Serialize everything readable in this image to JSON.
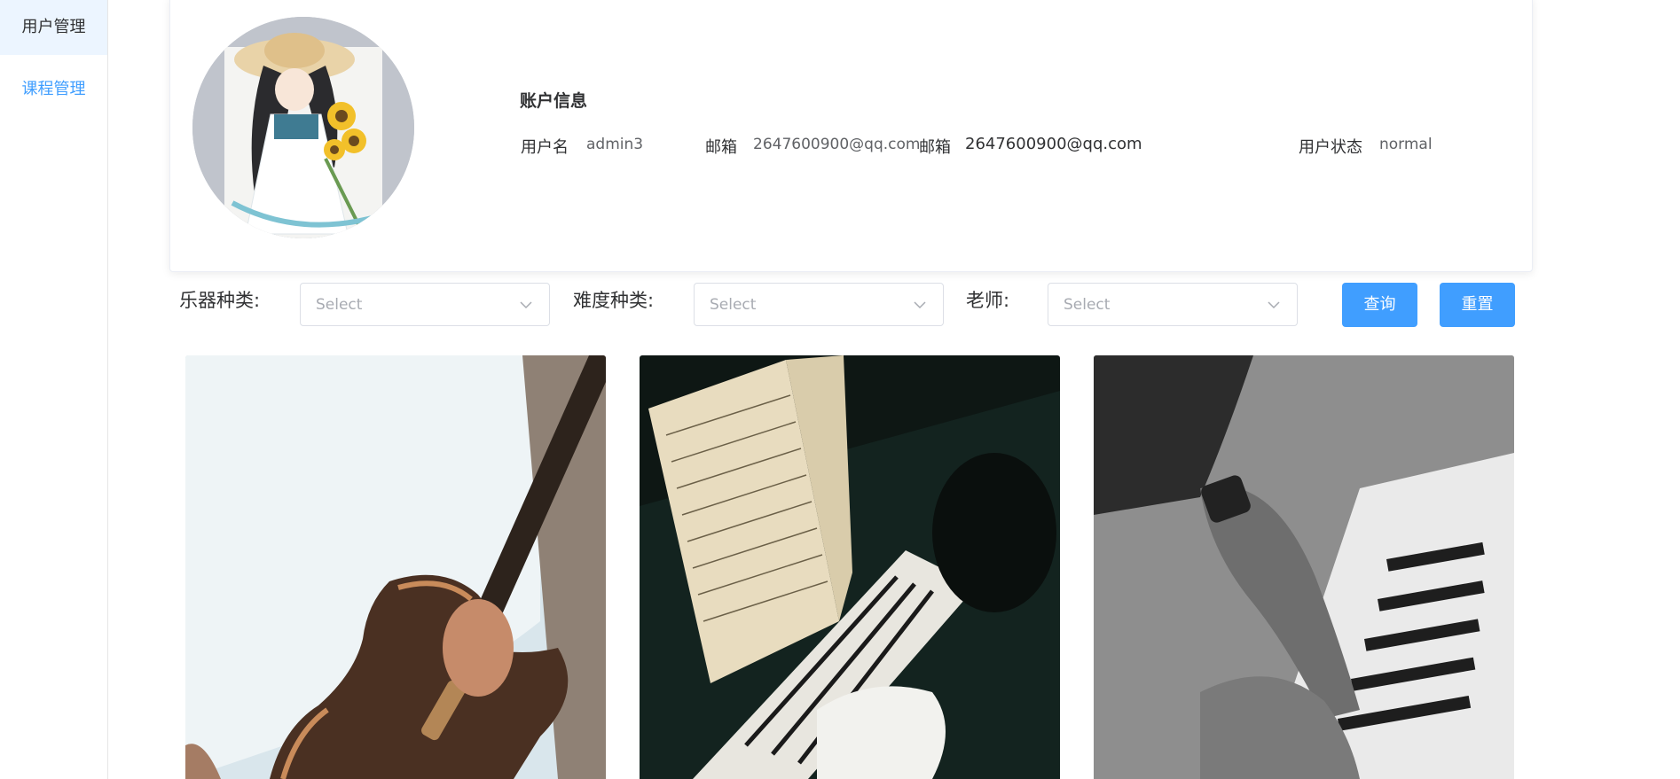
{
  "sidebar": {
    "items": [
      {
        "label": "用户管理"
      },
      {
        "label": "课程管理"
      }
    ]
  },
  "account": {
    "title": "账户信息",
    "username_label": "用户名",
    "username_value": "admin3",
    "email_label": "邮箱",
    "email_value": "2647600900@qq.com",
    "email_label_2": "邮箱",
    "email_value_2": "2647600900@qq.com",
    "status_label": "用户状态",
    "status_value": "normal"
  },
  "filters": {
    "instrument_label": "乐器种类:",
    "difficulty_label": "难度种类:",
    "teacher_label": "老师:",
    "placeholder": "Select",
    "query_button": "查询",
    "reset_button": "重置"
  },
  "courses": [
    {
      "icon": "guitar-photo"
    },
    {
      "icon": "piano-sheet-music-photo"
    },
    {
      "icon": "piano-hands-photo"
    }
  ],
  "colors": {
    "accent": "#409eff",
    "active_bg": "#ecf5ff"
  }
}
